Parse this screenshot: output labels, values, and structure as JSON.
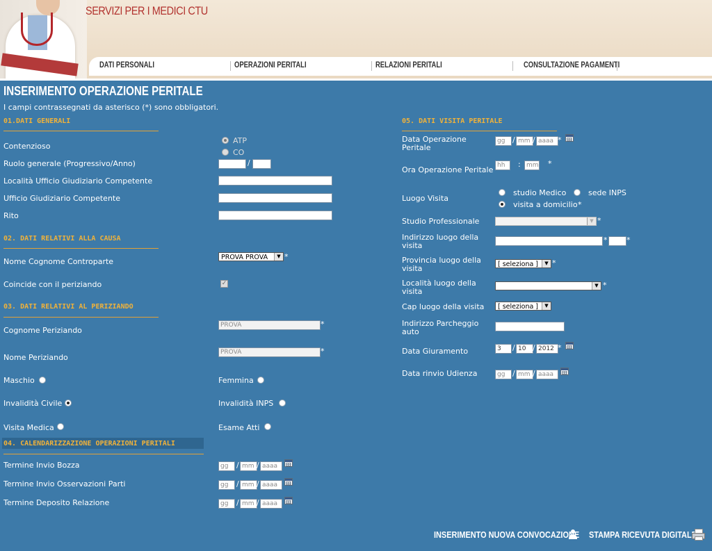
{
  "header": {
    "site_title": "SERVIZI PER I MEDICI CTU",
    "nav": [
      "DATI PERSONALI",
      "OPERAZIONI PERITALI",
      "RELAZIONI PERITALI",
      "CONSULTAZIONE PAGAMENTI"
    ]
  },
  "page": {
    "title": "INSERIMENTO OPERAZIONE PERITALE",
    "required_note": "I campi contrassegnati da asterisco (*) sono obbligatori."
  },
  "sec1": {
    "title": "01.DATI GENERALI",
    "contenzioso_label": "Contenzioso",
    "opt_atp": "ATP",
    "opt_co": "CO",
    "contenzioso_selected": "ATP",
    "ruolo_label": "Ruolo generale (Progressivo/Anno)",
    "localita_label": "Località Ufficio Giudiziario Competente",
    "ufficio_label": "Ufficio Giudiziario Competente",
    "rito_label": "Rito"
  },
  "sec2": {
    "title": "02. DATI RELATIVI ALLA CAUSA",
    "controparte_label": "Nome Cognome Controparte",
    "controparte_value": "PROVA PROVA",
    "coincide_label": "Coincide con il periziando",
    "coincide_checked": true
  },
  "sec3": {
    "title": "03. DATI RELATIVI AL PERIZIANDO",
    "cognome_label": "Cognome Periziando",
    "cognome_value": "PROVA",
    "nome_label": "Nome Periziando",
    "nome_value": "PROVA",
    "maschio_label": "Maschio",
    "femmina_label": "Femmina",
    "inv_civile_label": "Invalidità Civile",
    "inv_inps_label": "Invalidità INPS",
    "visita_label": "Visita Medica",
    "esame_label": "Esame Atti"
  },
  "sec4": {
    "title": "04. CALENDARIZZAZIONE OPERAZIONI PERITALI",
    "bozza_label": "Termine Invio Bozza",
    "osservazioni_label": "Termine Invio Osservazioni Parti",
    "deposito_label": "Termine Deposito Relazione"
  },
  "sec5": {
    "title": "05. DATI VISITA PERITALE",
    "data_op_label_1": "Data Operazione",
    "data_op_label_2": "Peritale",
    "ora_label": "Ora Operazione Peritale",
    "luogo_label": "Luogo Visita",
    "opt_studio": "studio Medico",
    "opt_inps": "sede INPS",
    "opt_domicilio": "visita a domicilio",
    "luogo_selected": "visita a domicilio",
    "studio_prof_label": "Studio Professionale",
    "indirizzo_label_1": "Indirizzo luogo della",
    "indirizzo_label_2": "visita",
    "provincia_label_1": "Provincia luogo della",
    "provincia_label_2": "visita",
    "provincia_value": "[ seleziona ]",
    "localita_label_1": "Località luogo della",
    "localita_label_2": "visita",
    "cap_label": "Cap luogo della visita",
    "cap_value": "[ seleziona ]",
    "parcheggio_label_1": "Indirizzo Parcheggio",
    "parcheggio_label_2": "auto",
    "giuramento_label": "Data Giuramento",
    "giuramento_dd": "3",
    "giuramento_mm": "10",
    "giuramento_yyyy": "2012",
    "rinvio_label": "Data rinvio Udienza"
  },
  "placeholders": {
    "gg": "gg",
    "mm": "mm",
    "aaaa": "aaaa",
    "hh": "hh",
    "min": "mm"
  },
  "footer": {
    "nuova_convocazione": "INSERIMENTO NUOVA CONVOCAZIONE",
    "stampa_ricevuta": "STAMPA RICEVUTA DIGITALE"
  },
  "symbols": {
    "star": "*",
    "slash": "/",
    "colon": ":",
    "arrow": "▼",
    "check": "✓"
  },
  "icons": [
    "person-icon",
    "printer-icon",
    "calendar-icon",
    "doctor-illustration"
  ],
  "colors": {
    "background": "#3d7aa9",
    "section_title": "#f0b23a",
    "site_title": "#b2332f"
  }
}
